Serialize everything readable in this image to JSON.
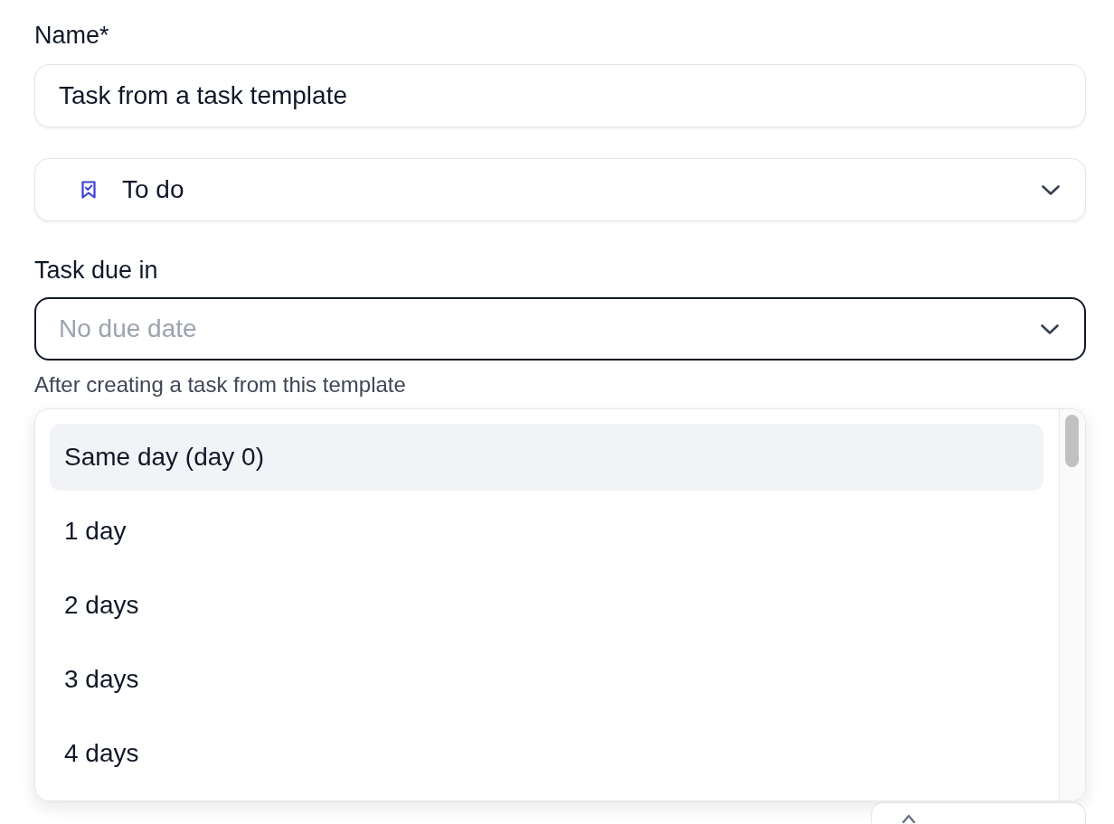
{
  "name_field": {
    "label": "Name*",
    "value": "Task from a task template"
  },
  "status_select": {
    "value": "To do"
  },
  "due_select": {
    "label": "Task due in",
    "placeholder": "No due date",
    "focused": true,
    "help_text": "After creating a task from this template",
    "expanded": true,
    "options": [
      {
        "label": "Same day (day 0)",
        "selected": true
      },
      {
        "label": "1 day",
        "selected": false
      },
      {
        "label": "2 days",
        "selected": false
      },
      {
        "label": "3 days",
        "selected": false
      },
      {
        "label": "4 days",
        "selected": false
      }
    ]
  }
}
